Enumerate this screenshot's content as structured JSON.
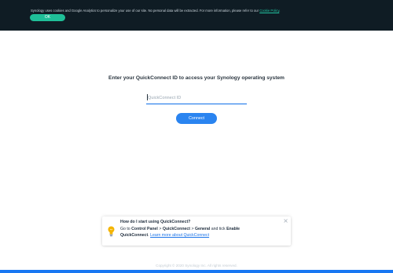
{
  "cookie_banner": {
    "text": "Synology uses cookies and Google Analytics to personalize your use of our site. No personal data will be extracted. For more information, please refer to our",
    "link_text": "Cookie Policy",
    "link_suffix": ".",
    "ok_label": "OK"
  },
  "main": {
    "title": "Enter your QuickConnect ID to access your Synology operating system",
    "input_placeholder": "QuickConnect ID",
    "input_value": "",
    "connect_label": "Connect"
  },
  "help": {
    "title": "How do I start using QuickConnect?",
    "line_prefix": "Go to",
    "control_panel": "Control Panel",
    "sep1": ">",
    "quickconnect": "QuickConnect",
    "sep2": ">",
    "general": "General",
    "and_tick": "and tick",
    "enable": "Enable",
    "enable_target": "QuickConnect",
    "period": ".",
    "link_text": "Learn more about QuickConnect"
  },
  "footer": {
    "copyright": "Copyright © 2020 Synology Inc. All rights reserved."
  },
  "icons": {
    "help_icon": "lightbulb-icon",
    "close_icon": "close-icon"
  },
  "colors": {
    "banner_bg": "#0f1c24",
    "ok_button": "#1fbf98",
    "primary_blue": "#2a84f0",
    "link_blue": "#1a73e8",
    "bulb_yellow": "#f4b400"
  }
}
